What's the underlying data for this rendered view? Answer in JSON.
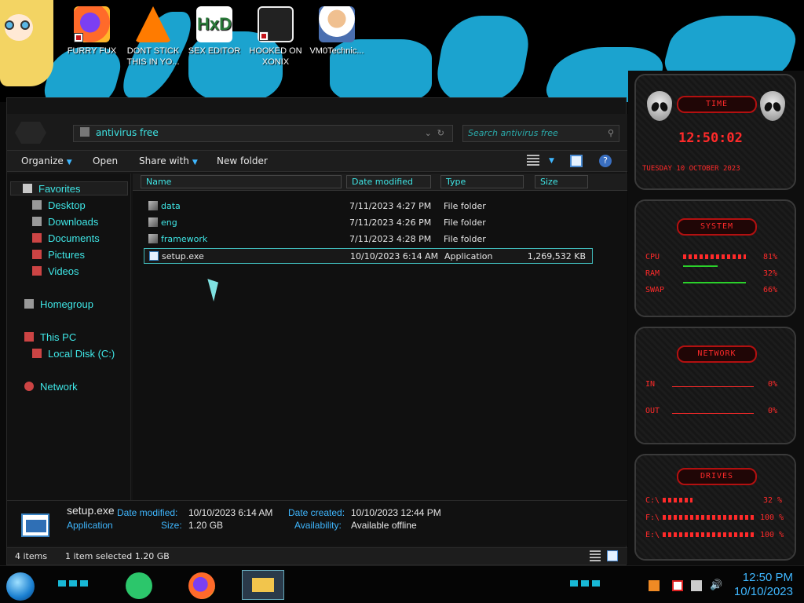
{
  "desktop": {
    "icons": [
      {
        "label": "FURRY FUX"
      },
      {
        "label": "DONT STICK THIS IN YO..."
      },
      {
        "label": "SEX EDITOR"
      },
      {
        "label": "HOOKED ON XONIX"
      },
      {
        "label": "VM0Technic..."
      }
    ]
  },
  "explorer": {
    "address": "antivirus free",
    "search_placeholder": "Search antivirus free",
    "toolbar": {
      "organize": "Organize",
      "open": "Open",
      "share_with": "Share with",
      "new_folder": "New folder"
    },
    "nav": {
      "favorites": "Favorites",
      "desktop": "Desktop",
      "downloads": "Downloads",
      "documents": "Documents",
      "pictures": "Pictures",
      "videos": "Videos",
      "homegroup": "Homegroup",
      "this_pc": "This PC",
      "local_disk": "Local Disk (C:)",
      "network": "Network"
    },
    "columns": {
      "name": "Name",
      "date_modified": "Date modified",
      "type": "Type",
      "size": "Size"
    },
    "files": [
      {
        "name": "data",
        "date": "7/11/2023 4:27 PM",
        "type": "File folder",
        "size": ""
      },
      {
        "name": "eng",
        "date": "7/11/2023 4:26 PM",
        "type": "File folder",
        "size": ""
      },
      {
        "name": "framework",
        "date": "7/11/2023 4:28 PM",
        "type": "File folder",
        "size": ""
      },
      {
        "name": "setup.exe",
        "date": "10/10/2023 6:14 AM",
        "type": "Application",
        "size": "1,269,532 KB"
      }
    ],
    "details": {
      "filename": "setup.exe",
      "filetype": "Application",
      "date_modified_label": "Date modified:",
      "date_modified_value": "10/10/2023 6:14 AM",
      "size_label": "Size:",
      "size_value": "1.20 GB",
      "date_created_label": "Date created:",
      "date_created_value": "10/10/2023 12:44 PM",
      "availability_label": "Availability:",
      "availability_value": "Available offline"
    },
    "status": {
      "items": "4 items",
      "selected": "1 item selected  1.20 GB"
    }
  },
  "gadgets": {
    "time": {
      "title": "TIME",
      "clock": "12:50:02",
      "date": "TUESDAY 10 OCTOBER 2023"
    },
    "system": {
      "title": "SYSTEM",
      "cpu_label": "CPU",
      "cpu_value": "81%",
      "ram_label": "RAM",
      "ram_value": "32%",
      "swap_label": "SWAP",
      "swap_value": "66%"
    },
    "network": {
      "title": "NETWORK",
      "in_label": "IN",
      "in_value": "0%",
      "out_label": "OUT",
      "out_value": "0%"
    },
    "drives": {
      "title": "DRIVES",
      "d1_label": "C:\\",
      "d1_value": "32 %",
      "d2_label": "F:\\",
      "d2_value": "100 %",
      "d3_label": "E:\\",
      "d3_value": "100 %"
    }
  },
  "taskbar": {
    "time": "12:50 PM",
    "date": "10/10/2023"
  },
  "colors": {
    "accent_cyan": "#3fe6e6",
    "accent_blue": "#3fb7ff",
    "gadget_red": "#ff2a2a"
  }
}
